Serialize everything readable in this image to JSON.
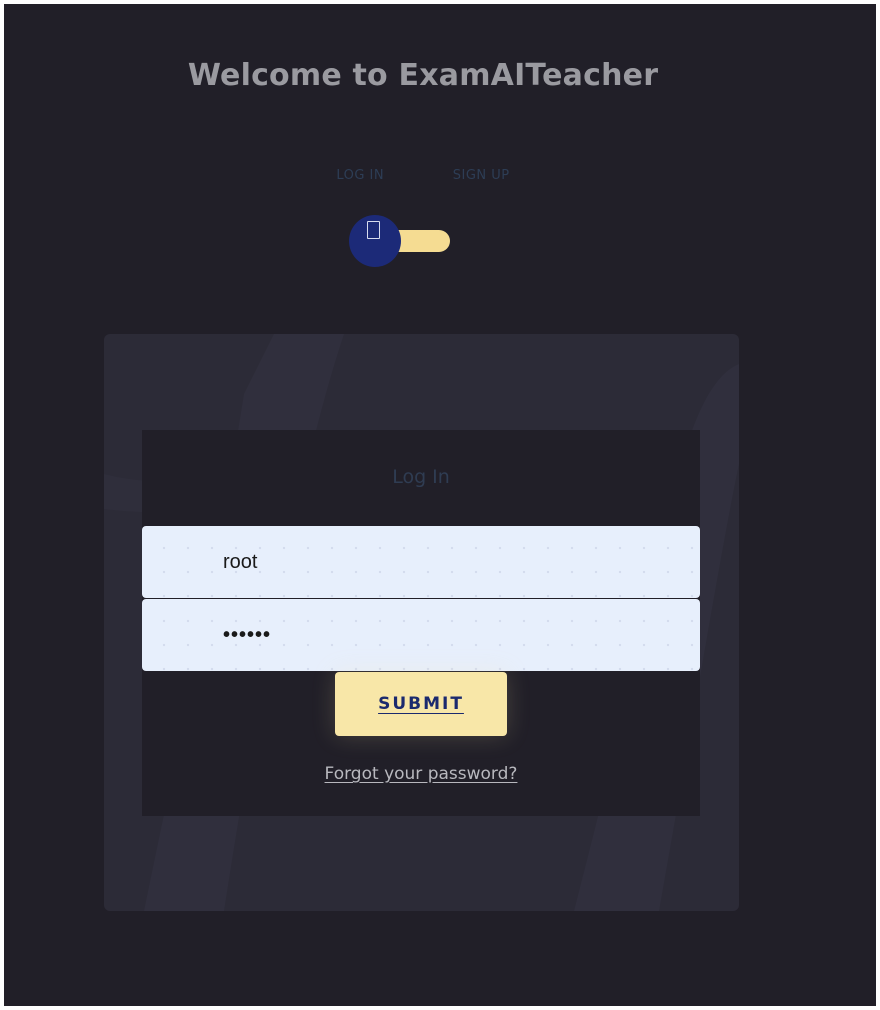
{
  "header": {
    "title": "Welcome to ExamAITeacher"
  },
  "mode_switch": {
    "login_label": "LOG IN",
    "signup_label": "SIGN UP",
    "knob_icon": "card-icon",
    "active": "LOG IN"
  },
  "form": {
    "title": "Log In",
    "username_value": "root",
    "password_value": "••••••",
    "submit_label": "SUBMIT",
    "forgot_label": "Forgot your password?"
  },
  "colors": {
    "background": "#211f28",
    "card": "#2c2b37",
    "accent_yellow": "#f8e7a8",
    "knob_blue": "#1c2a78",
    "field_bg": "#e7effc"
  }
}
